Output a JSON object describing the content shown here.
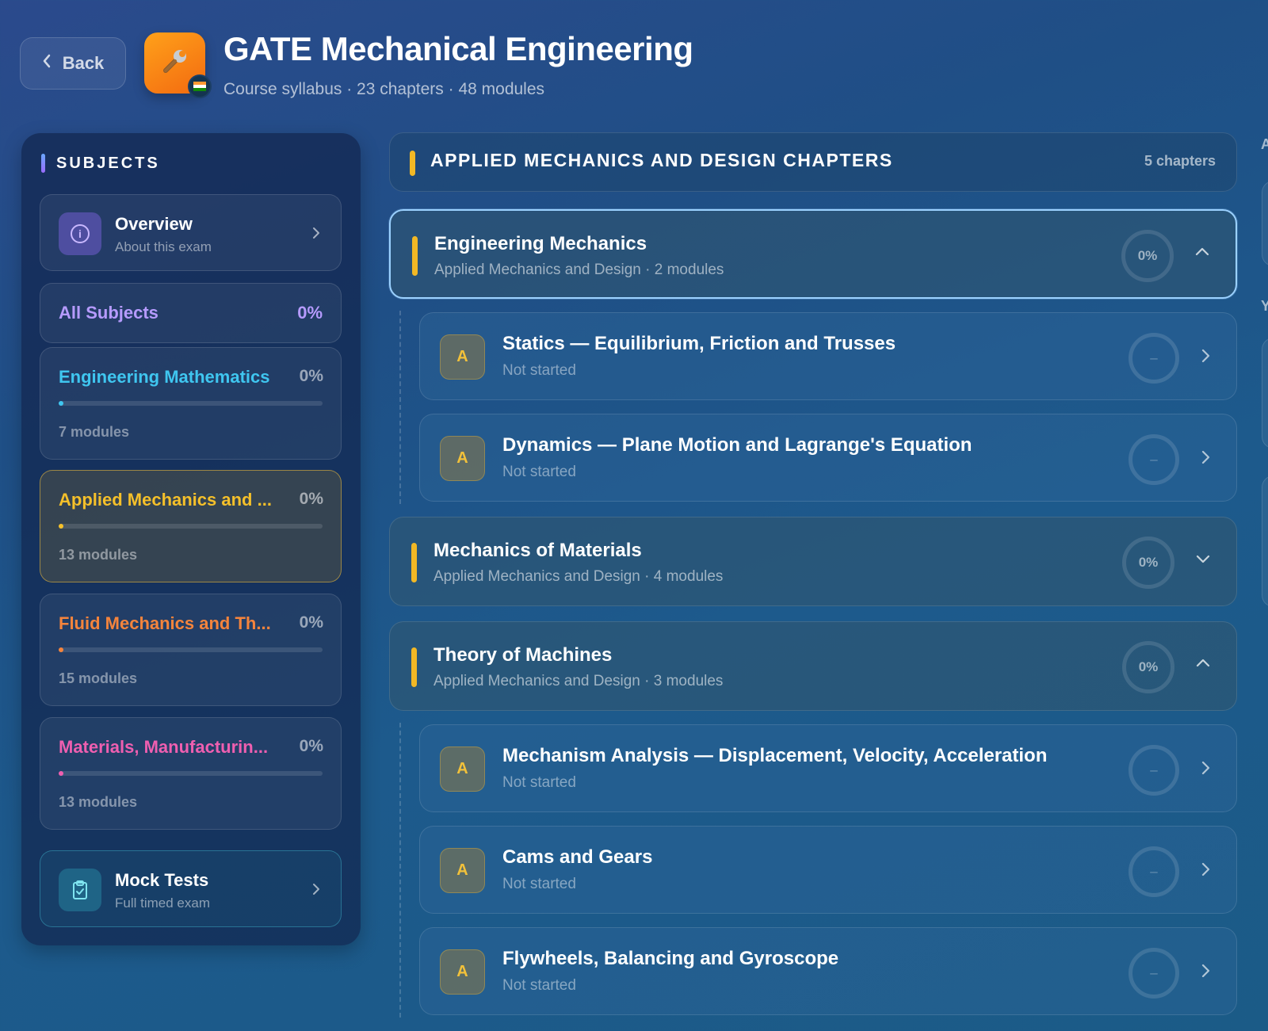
{
  "header": {
    "back_label": "Back",
    "title": "GATE Mechanical Engineering",
    "subtitle": "Course syllabus · 23 chapters · 48 modules",
    "logo_icon": "wrench-icon",
    "badge_icon": "india-flag-icon"
  },
  "sidebar": {
    "heading": "SUBJECTS",
    "overview": {
      "title": "Overview",
      "subtitle": "About this exam"
    },
    "all_subjects": {
      "label": "All Subjects",
      "progress": "0%"
    },
    "subjects": [
      {
        "name": "Engineering Mathematics",
        "progress": "0%",
        "modules": "7 modules",
        "color": "#3fc6f0"
      },
      {
        "name": "Applied Mechanics and ...",
        "progress": "0%",
        "modules": "13 modules",
        "color": "#f5c02a"
      },
      {
        "name": "Fluid Mechanics and Th...",
        "progress": "0%",
        "modules": "15 modules",
        "color": "#f5843c"
      },
      {
        "name": "Materials, Manufacturin...",
        "progress": "0%",
        "modules": "13 modules",
        "color": "#ef5fb0"
      }
    ],
    "mock_tests": {
      "title": "Mock Tests",
      "subtitle": "Full timed exam"
    }
  },
  "main": {
    "section_title": "APPLIED MECHANICS AND DESIGN CHAPTERS",
    "section_count": "5 chapters",
    "chapters": [
      {
        "name": "Engineering Mechanics",
        "meta": "Applied Mechanics and Design · 2 modules",
        "progress": "0%",
        "expanded": true,
        "modules": [
          {
            "avatar": "A",
            "title": "Statics — Equilibrium, Friction and Trusses",
            "status": "Not started",
            "ring": "–"
          },
          {
            "avatar": "A",
            "title": "Dynamics — Plane Motion and Lagrange's Equation",
            "status": "Not started",
            "ring": "–"
          }
        ]
      },
      {
        "name": "Mechanics of Materials",
        "meta": "Applied Mechanics and Design · 4 modules",
        "progress": "0%",
        "expanded": false
      },
      {
        "name": "Theory of Machines",
        "meta": "Applied Mechanics and Design · 3 modules",
        "progress": "0%",
        "expanded": true,
        "modules": [
          {
            "avatar": "A",
            "title": "Mechanism Analysis — Displacement, Velocity, Acceleration",
            "status": "Not started",
            "ring": "–"
          },
          {
            "avatar": "A",
            "title": "Cams and Gears",
            "status": "Not started",
            "ring": "–"
          },
          {
            "avatar": "A",
            "title": "Flywheels, Balancing and Gyroscope",
            "status": "Not started",
            "ring": "–"
          }
        ]
      }
    ]
  },
  "right_peek": {
    "letter_top": "A",
    "letter_mid": "Y"
  }
}
